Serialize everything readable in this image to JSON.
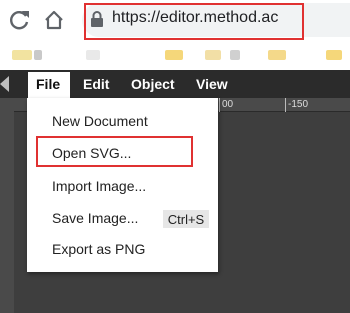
{
  "browser": {
    "url": "https://editor.method.ac"
  },
  "app": {
    "menubar": {
      "file": "File",
      "edit": "Edit",
      "object": "Object",
      "view": "View"
    },
    "ruler_labels": [
      "00",
      "-150"
    ],
    "file_menu": {
      "items": [
        {
          "label": "New Document"
        },
        {
          "label": "Open SVG..."
        },
        {
          "label": "Import Image..."
        },
        {
          "label": "Save Image...",
          "shortcut": "Ctrl+S"
        },
        {
          "label": "Export as PNG"
        }
      ]
    }
  },
  "colors": {
    "annotation": "#e03131",
    "menubar": "#2b2b2b",
    "canvas": "#3e3e3e"
  }
}
